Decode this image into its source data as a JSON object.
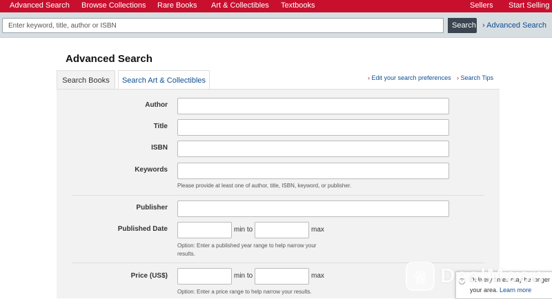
{
  "topnav": {
    "items": [
      "Advanced Search",
      "Browse Collections",
      "Rare Books",
      "Art & Collectibles",
      "Textbooks"
    ],
    "right": [
      "Sellers",
      "Start Selling"
    ]
  },
  "search": {
    "placeholder": "Enter keyword, title, author or ISBN",
    "button": "Search",
    "advanced_link": "Advanced Search"
  },
  "page_title": "Advanced Search",
  "tabs": [
    {
      "label": "Search Books",
      "active": true
    },
    {
      "label": "Search Art & Collectibles",
      "active": false
    }
  ],
  "links": {
    "preferences": "Edit your search preferences",
    "tips": "Search Tips",
    "chevron": "›"
  },
  "form": {
    "author": "Author",
    "title": "Title",
    "isbn": "ISBN",
    "keywords": "Keywords",
    "keywords_note": "Please provide at least one of author, title, ISBN, keyword, or publisher.",
    "publisher": "Publisher",
    "published_date": "Published Date",
    "min_to": "min to",
    "max": "max",
    "date_note_1": "Option: Enter a published year range to help narrow your",
    "date_note_2": "results.",
    "price": "Price (US$)",
    "price_note": "Option: Enter a price range to help narrow your results."
  },
  "watermark": {
    "text": "DealMoon",
    "logo_glyph": "省"
  },
  "toast": {
    "icon": "i",
    "line1": "Delivery times may be longer",
    "line2": "your area.",
    "link": "Learn more"
  },
  "colors": {
    "brand_red": "#c8102e",
    "link_blue": "#0e4d92",
    "search_button": "#3b4550"
  }
}
